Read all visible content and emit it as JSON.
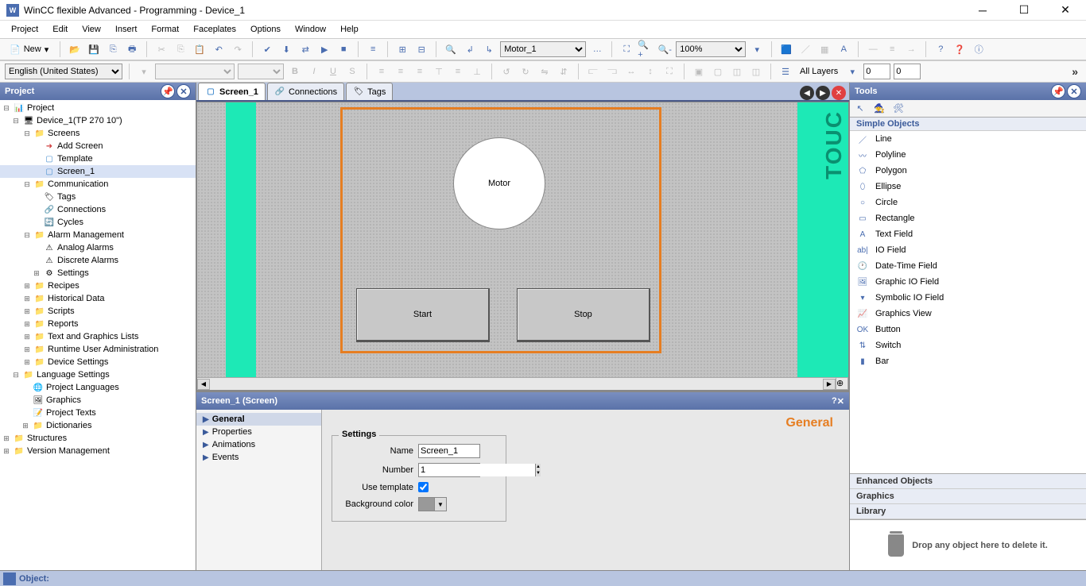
{
  "title": "WinCC flexible Advanced - Programming - Device_1",
  "menu": [
    "Project",
    "Edit",
    "View",
    "Insert",
    "Format",
    "Faceplates",
    "Options",
    "Window",
    "Help"
  ],
  "toolbar1": {
    "new": "New",
    "tagSelect": "Motor_1",
    "zoom": "100%"
  },
  "toolbar2": {
    "lang": "English (United States)",
    "allLayers": "All Layers",
    "layerA": "0",
    "layerB": "0"
  },
  "projectPanel": {
    "title": "Project",
    "tree": {
      "root": "Project",
      "device": "Device_1(TP 270 10\")",
      "screens": "Screens",
      "addScreen": "Add Screen",
      "template": "Template",
      "screen1": "Screen_1",
      "communication": "Communication",
      "tags": "Tags",
      "connections": "Connections",
      "cycles": "Cycles",
      "alarmMgmt": "Alarm Management",
      "analogAlarms": "Analog Alarms",
      "discreteAlarms": "Discrete Alarms",
      "settings": "Settings",
      "recipes": "Recipes",
      "historical": "Historical Data",
      "scripts": "Scripts",
      "reports": "Reports",
      "textgraphics": "Text and Graphics Lists",
      "runtimeUser": "Runtime User Administration",
      "deviceSettings": "Device Settings",
      "langSettings": "Language Settings",
      "projLang": "Project Languages",
      "graphics": "Graphics",
      "projTexts": "Project Texts",
      "dictionaries": "Dictionaries",
      "structures": "Structures",
      "versionMgmt": "Version Management"
    }
  },
  "tabs": {
    "screen1": "Screen_1",
    "connections": "Connections",
    "tags": "Tags"
  },
  "canvas": {
    "motor": "Motor",
    "start": "Start",
    "stop": "Stop",
    "sideText": "TOUC"
  },
  "props": {
    "title": "Screen_1 (Screen)",
    "nav": [
      "General",
      "Properties",
      "Animations",
      "Events"
    ],
    "sectionTitle": "General",
    "groupTitle": "Settings",
    "fields": {
      "name": "Name",
      "nameVal": "Screen_1",
      "number": "Number",
      "numberVal": "1",
      "useTemplate": "Use template",
      "bgcolor": "Background color"
    }
  },
  "toolsPanel": {
    "title": "Tools",
    "simpleObjects": "Simple Objects",
    "items": [
      "Line",
      "Polyline",
      "Polygon",
      "Ellipse",
      "Circle",
      "Rectangle",
      "Text Field",
      "IO Field",
      "Date-Time Field",
      "Graphic IO Field",
      "Symbolic IO Field",
      "Graphics View",
      "Button",
      "Switch",
      "Bar"
    ],
    "enhanced": "Enhanced Objects",
    "graphics": "Graphics",
    "library": "Library",
    "dropHint": "Drop any object here to delete it."
  },
  "statusbar": {
    "object": "Object:"
  }
}
